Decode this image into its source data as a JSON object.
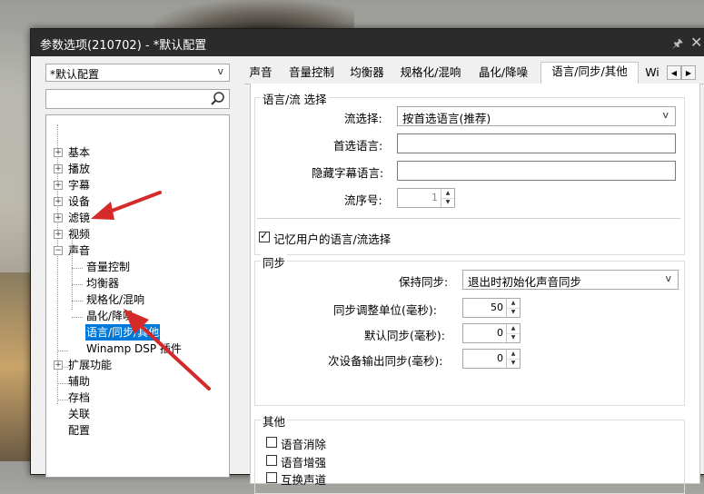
{
  "window": {
    "title": "参数选项(210702) - *默认配置"
  },
  "preset": {
    "value": "*默认配置"
  },
  "search": {
    "placeholder": ""
  },
  "tree": {
    "items": [
      "基本",
      "播放",
      "字幕",
      "设备",
      "滤镜",
      "视频",
      "声音",
      "音量控制",
      "均衡器",
      "规格化/混响",
      "晶化/降噪",
      "语言/同步/其他",
      "Winamp DSP 插件",
      "扩展功能",
      "辅助",
      "存档",
      "关联",
      "配置"
    ]
  },
  "tabs": [
    "声音",
    "音量控制",
    "均衡器",
    "规格化/混响",
    "晶化/降噪",
    "语言/同步/其他",
    "Wi"
  ],
  "lang_group": {
    "title": "语言/流 选择",
    "stream_select_label": "流选择:",
    "stream_select_value": "按首选语言(推荐)",
    "preferred_lang_label": "首选语言:",
    "preferred_lang_value": "",
    "hidden_sub_label": "隐藏字幕语言:",
    "hidden_sub_value": "",
    "stream_no_label": "流序号:",
    "stream_no_value": "1",
    "remember_label": "记忆用户的语言/流选择",
    "remember_checked": true
  },
  "sync_group": {
    "title": "同步",
    "keep_sync_label": "保持同步:",
    "keep_sync_value": "退出时初始化声音同步",
    "adjust_unit_label": "同步调整单位(毫秒):",
    "adjust_unit_value": "50",
    "default_sync_label": "默认同步(毫秒):",
    "default_sync_value": "0",
    "secondary_sync_label": "次设备输出同步(毫秒):",
    "secondary_sync_value": "0"
  },
  "other_group": {
    "title": "其他",
    "voice_cancel_label": "语音消除",
    "voice_enhance_label": "语音增强",
    "swap_channels_label": "互换声道"
  },
  "colors": {
    "selection": "#0078d7",
    "annotation_arrow": "#d42a2a",
    "titlebar": "#2b2b2b"
  }
}
